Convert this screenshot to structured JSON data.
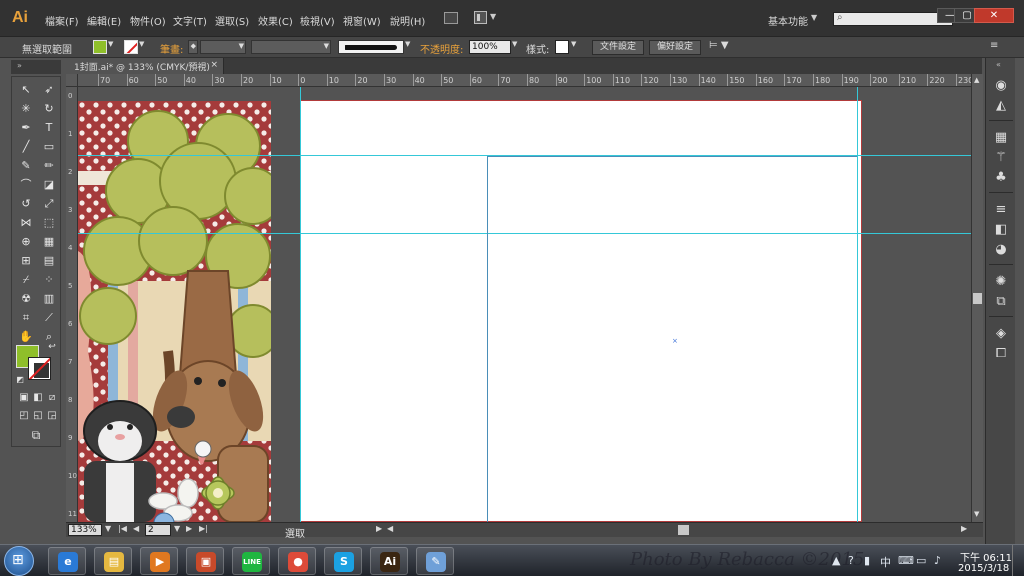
{
  "app": {
    "logo": "Ai"
  },
  "menu": {
    "items": [
      "檔案(F)",
      "編輯(E)",
      "物件(O)",
      "文字(T)",
      "選取(S)",
      "效果(C)",
      "檢視(V)",
      "視窗(W)",
      "說明(H)"
    ],
    "workspace": "基本功能"
  },
  "control_bar": {
    "selection_label": "無選取範圍",
    "stroke_label": "筆畫:",
    "opacity_label": "不透明度:",
    "opacity_value": "100%",
    "style_label": "樣式:",
    "doc_setup_button": "文件設定",
    "preferences_button": "偏好設定"
  },
  "document": {
    "tab_title": "1封面.ai* @ 133% (CMYK/預視)",
    "close_glyph": "×"
  },
  "rulers": {
    "horizontal": [
      "70",
      "60",
      "50",
      "40",
      "30",
      "20",
      "10",
      "0",
      "10",
      "20",
      "30",
      "40",
      "50",
      "60",
      "70",
      "80",
      "90",
      "100",
      "110",
      "120",
      "130",
      "140",
      "150",
      "160",
      "170",
      "180",
      "190",
      "200",
      "210",
      "220",
      "230"
    ],
    "vertical": [
      "0",
      "1",
      "2",
      "3",
      "4",
      "5",
      "6",
      "7",
      "8",
      "9",
      "10",
      "11",
      "12"
    ]
  },
  "status": {
    "zoom": "133%",
    "page": "2",
    "text": "選取"
  },
  "taskbar": {
    "watermark": "Photo By Rebacca ©2015",
    "time": "下午 06:11",
    "date": "2015/3/18",
    "apps": [
      {
        "name": "ie",
        "glyph": "e",
        "color": "#2a7ad6"
      },
      {
        "name": "explorer",
        "glyph": "▤",
        "color": "#e5b840"
      },
      {
        "name": "media-player",
        "glyph": "▶",
        "color": "#e07820"
      },
      {
        "name": "archive",
        "glyph": "▣",
        "color": "#c84a2a"
      },
      {
        "name": "line",
        "glyph": "LINE",
        "color": "#1fb640"
      },
      {
        "name": "chrome",
        "glyph": "●",
        "color": "#dd4b39"
      },
      {
        "name": "skype",
        "glyph": "S",
        "color": "#1ba1e2"
      },
      {
        "name": "illustrator",
        "glyph": "Ai",
        "color": "#3a2612"
      },
      {
        "name": "paint",
        "glyph": "✎",
        "color": "#6fa0d8"
      }
    ]
  },
  "colors": {
    "fill": "#8fbf2a",
    "guide": "#35c8d8",
    "artboard_border": "#b23a3a",
    "ai_orange": "#e8a13b"
  }
}
